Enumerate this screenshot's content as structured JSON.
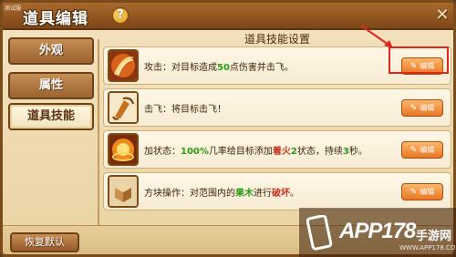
{
  "window": {
    "corner_tag": "测试服",
    "title": "道具编辑",
    "help_glyph": "?",
    "close_glyph": "✕"
  },
  "sidebar": {
    "items": [
      {
        "label": "外观"
      },
      {
        "label": "属性"
      },
      {
        "label": "道具技能"
      }
    ],
    "active_index": 2
  },
  "panel": {
    "header": "道具技能设置",
    "edit_label": "编辑",
    "skills": [
      {
        "icon": "sword-slash-icon",
        "parts": [
          "攻击：对目标造成",
          "50",
          "点伤害并击飞。"
        ]
      },
      {
        "icon": "knockback-icon",
        "parts": [
          "击飞：将目标击飞！"
        ]
      },
      {
        "icon": "fire-status-icon",
        "parts": [
          "加状态：",
          "100%",
          "几率给目标添加",
          "着火",
          "2",
          "状态，持续",
          "3",
          "秒。"
        ]
      },
      {
        "icon": "block-icon",
        "parts": [
          "方块操作：对范围内的",
          "果木",
          "进行",
          "破坏",
          "。"
        ]
      }
    ]
  },
  "footer": {
    "reset_label": "恢复默认"
  },
  "watermark": {
    "main": "APP178",
    "sub": "手游网",
    "url": "WWW.APP178.COM"
  },
  "colors": {
    "frame": "#7b4b1c",
    "title_bar": "#a9692c",
    "panel_bg": "#f3e3bf",
    "edit_button": "#e67825",
    "highlight_green": "#2c9a16",
    "highlight_red": "#c7331e",
    "annotation_red": "#e0271e"
  }
}
